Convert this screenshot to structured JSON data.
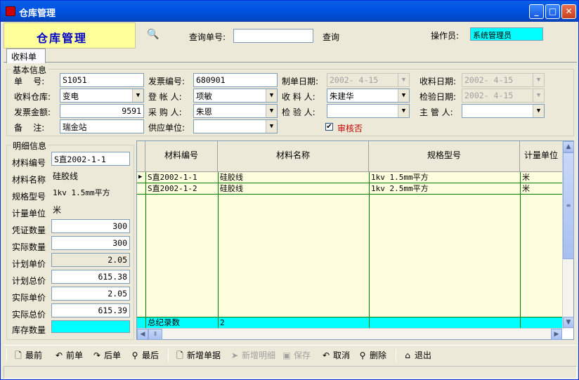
{
  "window": {
    "title": "仓库管理"
  },
  "header": {
    "brand": "仓库管理",
    "query_label": "查询单号:",
    "query_value": "",
    "query_button": "查询",
    "operator_label": "操作员:",
    "operator_value": "系统管理员"
  },
  "tabs": [
    {
      "label": "收料单"
    }
  ],
  "basic": {
    "title": "基本信息",
    "doc_no_label": "单    号:",
    "doc_no": "S1051",
    "invoice_no_label": "发票编号:",
    "invoice_no": "680901",
    "create_date_label": "制单日期:",
    "create_date": "2002- 4-15",
    "receive_date_label": "收料日期:",
    "receive_date": "2002- 4-15",
    "warehouse_label": "收料仓库:",
    "warehouse": "变电",
    "registrar_label": "登 帐 人:",
    "registrar": "项敏",
    "receiver_label": "收 料 人:",
    "receiver": "朱建华",
    "inspect_date_label": "检验日期:",
    "inspect_date": "2002- 4-15",
    "invoice_amount_label": "发票金额:",
    "invoice_amount": "9591",
    "buyer_label": "采 购 人:",
    "buyer": "朱恩",
    "inspector_label": "检 验 人:",
    "inspector": "",
    "supervisor_label": "主 管 人:",
    "supervisor": "",
    "remark_label": "备    注:",
    "remark": "瑞金站",
    "supplier_label": "供应单位:",
    "supplier": "",
    "audit_label": "审核否",
    "audited": true
  },
  "detail": {
    "title": "明细信息",
    "material_code_label": "材料编号",
    "material_code": "S直2002-1-1",
    "material_name_label": "材料名称",
    "material_name": "硅胶线",
    "spec_label": "规格型号",
    "spec": "1kv 1.5mm平方",
    "unit_label": "计量单位",
    "unit": "米",
    "voucher_qty_label": "凭证数量",
    "voucher_qty": "300",
    "actual_qty_label": "实际数量",
    "actual_qty": "300",
    "plan_price_label": "计划单价",
    "plan_price": "2.05",
    "plan_total_label": "计划总价",
    "plan_total": "615.38",
    "actual_price_label": "实际单价",
    "actual_price": "2.05",
    "actual_total_label": "实际总价",
    "actual_total": "615.39",
    "stock_qty_label": "库存数量",
    "stock_qty": ""
  },
  "grid": {
    "columns": [
      "材料编号",
      "材料名称",
      "规格型号",
      "计量单位"
    ],
    "rows": [
      [
        "S直2002-1-1",
        "硅胶线",
        "1kv 1.5mm平方",
        "米"
      ],
      [
        "S直2002-1-2",
        "硅胶线",
        "1kv 2.5mm平方",
        "米"
      ]
    ],
    "total_label": "总纪录数",
    "total_value": "2"
  },
  "toolbar": {
    "first": "最前",
    "prev": "前单",
    "next": "后单",
    "last": "最后",
    "new_doc": "新增单据",
    "new_detail": "新增明细",
    "save": "保存",
    "cancel": "取消",
    "delete": "删除",
    "exit": "退出"
  }
}
